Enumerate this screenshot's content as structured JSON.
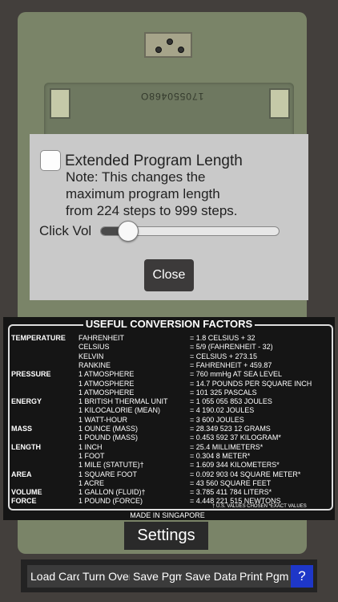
{
  "calculator": {
    "serial_number": "170550468O"
  },
  "dialog": {
    "checkbox_label": "Extended Program Length",
    "checkbox_checked": false,
    "note": "Note: This changes the\nmaximum program length\nfrom 224 steps to 999 steps.",
    "volume_label": "Click Vol",
    "volume_level": 0.15,
    "close_label": "Close"
  },
  "conversion": {
    "title": "USEFUL CONVERSION FACTORS",
    "rows": [
      {
        "category": "TEMPERATURE",
        "unit": "FAHRENHEIT",
        "value": "= 1.8 CELSIUS + 32"
      },
      {
        "category": "",
        "unit": "CELSIUS",
        "value": "= 5/9 (FAHRENHEIT - 32)"
      },
      {
        "category": "",
        "unit": "KELVIN",
        "value": "= CELSIUS + 273.15"
      },
      {
        "category": "",
        "unit": "RANKINE",
        "value": "= FAHRENHEIT + 459.87"
      },
      {
        "category": "PRESSURE",
        "unit": "1 ATMOSPHERE",
        "value": "= 760 mmHg AT SEA LEVEL"
      },
      {
        "category": "",
        "unit": "1 ATMOSPHERE",
        "value": "= 14.7 POUNDS PER SQUARE INCH"
      },
      {
        "category": "",
        "unit": "1 ATMOSPHERE",
        "value": "= 101 325 PASCALS"
      },
      {
        "category": "ENERGY",
        "unit": "1 BRITISH THERMAL UNIT",
        "value": "= 1 055 055 853 JOULES"
      },
      {
        "category": "",
        "unit": "1 KILOCALORIE (MEAN)",
        "value": "= 4 190.02 JOULES"
      },
      {
        "category": "",
        "unit": "1 WATT-HOUR",
        "value": "= 3 600 JOULES"
      },
      {
        "category": "MASS",
        "unit": "1 OUNCE (MASS)",
        "value": "= 28.349 523 12 GRAMS"
      },
      {
        "category": "",
        "unit": "1 POUND (MASS)",
        "value": "= 0.453 592 37 KILOGRAM*"
      },
      {
        "category": "LENGTH",
        "unit": "1 INCH",
        "value": "= 25.4 MILLIMETERS*"
      },
      {
        "category": "",
        "unit": "1 FOOT",
        "value": "= 0.304 8 METER*"
      },
      {
        "category": "",
        "unit": "1 MILE (STATUTE)†",
        "value": "= 1.609 344 KILOMETERS*"
      },
      {
        "category": "AREA",
        "unit": "1 SQUARE FOOT",
        "value": "= 0.092 903 04 SQUARE METER*"
      },
      {
        "category": "",
        "unit": "1 ACRE",
        "value": "= 43 560 SQUARE FEET"
      },
      {
        "category": "VOLUME",
        "unit": "1 GALLON (FLUID)†",
        "value": "= 3.785 411 784 LITERS*"
      },
      {
        "category": "FORCE",
        "unit": "1 POUND (FORCE)",
        "value": "= 4.448 221 515 NEWTONS"
      }
    ],
    "footnote": "† U.S. VALUES CHOSEN   *EXACT VALUES",
    "made_in": "MADE IN SINGAPORE"
  },
  "settings_label": "Settings",
  "toolbar": {
    "load_card": "Load Card",
    "turn_over": "Turn Over",
    "save_pgm": "Save Pgm",
    "save_data": "Save Data",
    "print_pgm": "Print Pgm",
    "help": "?"
  }
}
